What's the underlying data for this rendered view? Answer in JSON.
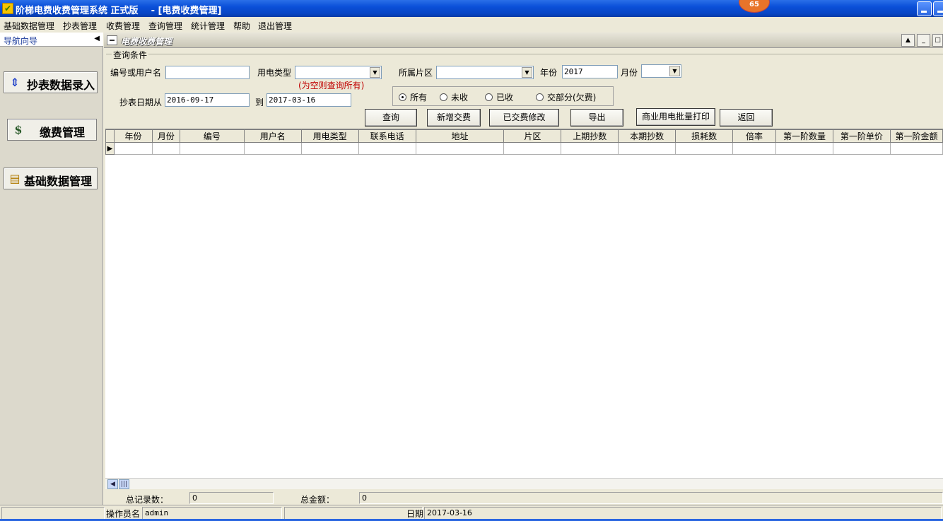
{
  "window": {
    "title": "阶梯电费收费管理系统 正式版    - [电费收费管理]",
    "badge": "65"
  },
  "menu": [
    "基础数据管理",
    "抄表管理",
    "收费管理",
    "查询管理",
    "统计管理",
    "帮助",
    "退出管理"
  ],
  "nav": {
    "header": "导航向导",
    "items": [
      {
        "label": "抄表数据录入",
        "icon": "meter-entry-icon"
      },
      {
        "label": "缴费管理",
        "icon": "money-bag-icon"
      },
      {
        "label": "基础数据管理",
        "icon": "data-folder-icon"
      }
    ]
  },
  "child": {
    "title": "电费收费管理"
  },
  "query": {
    "legend": "查询条件",
    "user_label": "编号或用户名",
    "user_value": "",
    "type_label": "用电类型",
    "type_value": "",
    "type_hint": "(为空则查询所有)",
    "area_label": "所属片区",
    "area_value": "",
    "year_label": "年份",
    "year_value": "2017",
    "month_label": "月份",
    "month_value": "",
    "date_from_label": "抄表日期从",
    "date_from": "2016-09-17",
    "date_to_label": "到",
    "date_to": "2017-03-16",
    "radios": [
      {
        "label": "所有",
        "checked": true
      },
      {
        "label": "未收",
        "checked": false
      },
      {
        "label": "已收",
        "checked": false
      },
      {
        "label": "交部分(欠费)",
        "checked": false
      }
    ]
  },
  "buttons": {
    "query": "查询",
    "add_payment": "新增交费",
    "edit_paid": "已交费修改",
    "export": "导出",
    "batch_print": "商业用电批量打印",
    "back": "返回"
  },
  "grid": {
    "columns": [
      "年份",
      "月份",
      "编号",
      "用户名",
      "用电类型",
      "联系电话",
      "地址",
      "片区",
      "上期抄数",
      "本期抄数",
      "损耗数",
      "倍率",
      "第一阶数量",
      "第一阶单价",
      "第一阶金额"
    ]
  },
  "footer": {
    "total_records_label": "总记录数：",
    "total_records": "0",
    "total_amount_label": "总金额：",
    "total_amount": "0"
  },
  "status": {
    "operator_label": "操作员名",
    "operator": "admin",
    "date_label": "日期",
    "date": "2017-03-16"
  }
}
